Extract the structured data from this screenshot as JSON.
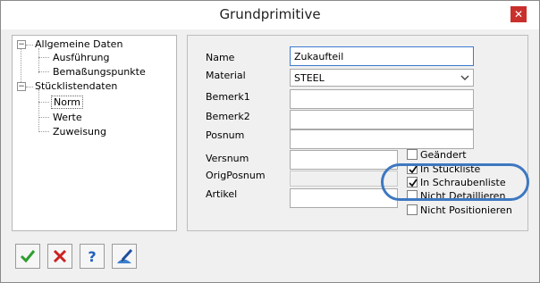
{
  "window": {
    "title": "Grundprimitive",
    "close_glyph": "✕"
  },
  "tree": {
    "groups": [
      {
        "label": "Allgemeine Daten",
        "toggle": "−",
        "children": [
          "Ausführung",
          "Bemaßungspunkte"
        ]
      },
      {
        "label": "Stücklistendaten",
        "toggle": "−",
        "children": [
          "Norm",
          "Werte",
          "Zuweisung"
        ],
        "selected": "Norm"
      }
    ]
  },
  "form": {
    "name_label": "Name",
    "name_value": "Zukaufteil",
    "material_label": "Material",
    "material_value": "STEEL",
    "bemerk1_label": "Bemerk1",
    "bemerk1_value": "",
    "bemerk2_label": "Bemerk2",
    "bemerk2_value": "",
    "posnum_label": "Posnum",
    "posnum_value": "",
    "versnum_label": "Versnum",
    "versnum_value": "",
    "origposnum_label": "OrigPosnum",
    "origposnum_value": "",
    "artikel_label": "Artikel",
    "artikel_value": ""
  },
  "checkboxes": [
    {
      "label": "Geändert",
      "checked": false
    },
    {
      "label": "In Stückliste",
      "checked": true
    },
    {
      "label": "In Schraubenliste",
      "checked": true
    },
    {
      "label": "Nicht Detaillieren",
      "checked": false
    },
    {
      "label": "Nicht Positionieren",
      "checked": false
    }
  ],
  "toolbar": {
    "icons": [
      "checkmark-icon",
      "cancel-x-icon",
      "help-question-icon",
      "edit-pen-icon"
    ]
  },
  "colors": {
    "highlight_ring": "#3e78c0",
    "close_button": "#c9302c",
    "ok_green": "#2e9e2e",
    "cancel_red": "#cc2222",
    "help_blue": "#1f5fbf"
  }
}
